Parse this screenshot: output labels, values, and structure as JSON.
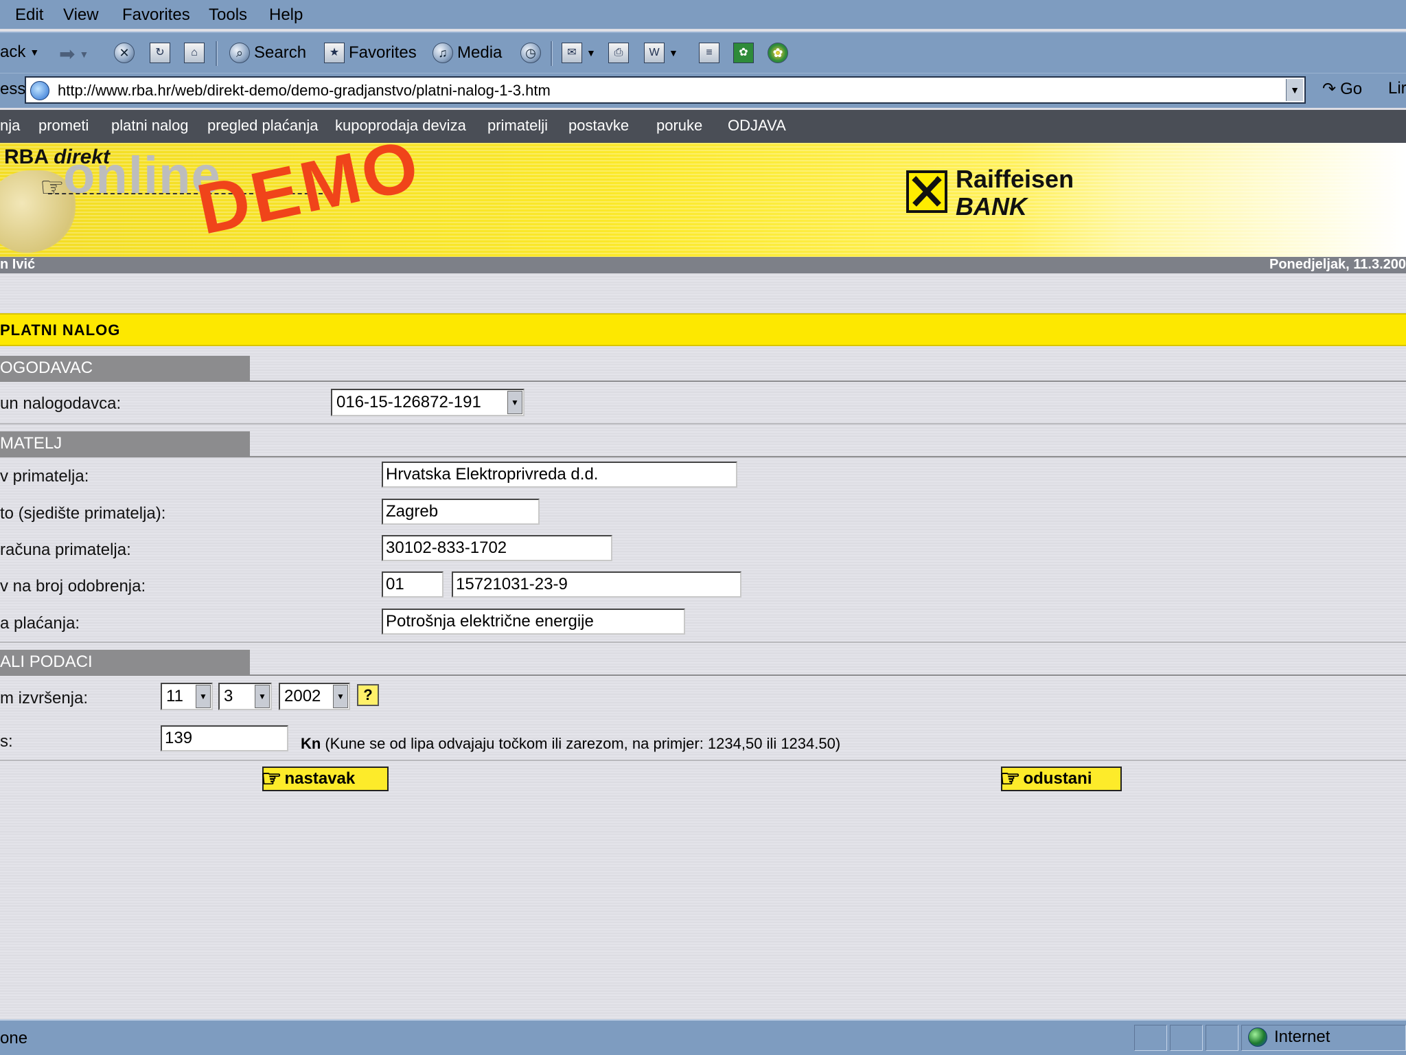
{
  "browser": {
    "menu": [
      "Edit",
      "View",
      "Favorites",
      "Tools",
      "Help"
    ],
    "toolbar": {
      "back": "ack",
      "search": "Search",
      "favorites": "Favorites",
      "media": "Media"
    },
    "address": {
      "label": "ess",
      "url": "http://www.rba.hr/web/direkt-demo/demo-gradjanstvo/platni-nalog-1-3.htm",
      "go": "Go",
      "links": "Lir"
    },
    "status": {
      "text": "one",
      "zone": "Internet"
    }
  },
  "site_nav": [
    "nja",
    "prometi",
    "platni nalog",
    "pregled plaćanja",
    "kupoprodaja deviza",
    "primatelji",
    "postavke",
    "poruke",
    "ODJAVA"
  ],
  "banner": {
    "rba": "RBA",
    "direkt": "direkt",
    "online": "online",
    "demo": "DEMO",
    "bank_name": "Raiffeisen",
    "bank_sub": "BANK"
  },
  "user": {
    "name": "n Ivić",
    "date": "Ponedjeljak, 11.3.200"
  },
  "page_title": "PLATNI NALOG",
  "sections": {
    "payer": {
      "header": "OGODAVAC",
      "account_label": "un nalogodavca:",
      "account_value": "016-15-126872-191"
    },
    "recipient": {
      "header": "MATELJ",
      "name_label": "v primatelja:",
      "name_value": "Hrvatska Elektroprivreda d.d.",
      "city_label": "to (sjedište primatelja):",
      "city_value": "Zagreb",
      "account_label": "računa primatelja:",
      "account_value": "30102-833-1702",
      "ref_label": "v na broj odobrenja:",
      "ref_model": "01",
      "ref_number": "15721031-23-9",
      "purpose_label": "a plaćanja:",
      "purpose_value": "Potrošnja električne energije"
    },
    "other": {
      "header": "ALI PODACI",
      "date_label": "m izvršenja:",
      "day": "11",
      "month": "3",
      "year": "2002",
      "help": "?",
      "amount_label": "s:",
      "amount_value": "139",
      "currency": "Kn",
      "hint": "(Kune se od lipa odvajaju točkom ili zarezom, na primjer: 1234,50 ili 1234.50)"
    }
  },
  "actions": {
    "continue": "nastavak",
    "cancel": "odustani"
  }
}
